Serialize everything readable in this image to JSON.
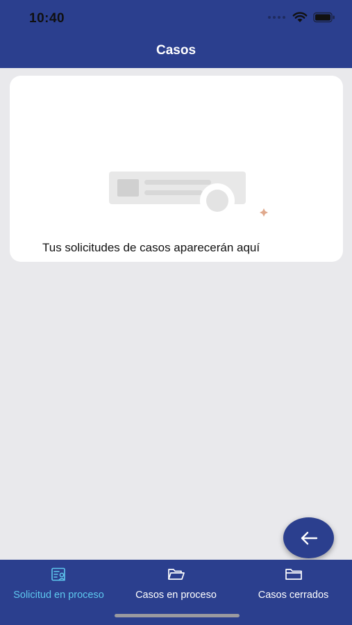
{
  "status_bar": {
    "time": "10:40",
    "icons": [
      "signal-dots-icon",
      "wifi-icon",
      "battery-icon"
    ]
  },
  "header": {
    "title": "Casos",
    "background_color": "#2b3f8e"
  },
  "empty_state": {
    "illustration": "empty-cases-illustration",
    "message": "Tus solicitudes de casos aparecerán aquí"
  },
  "fab": {
    "icon": "arrow-left-icon"
  },
  "bottom_nav": {
    "active_color": "#5ec8ef",
    "items": [
      {
        "label": "Solicitud en proceso",
        "icon": "document-user-icon",
        "active": true
      },
      {
        "label": "Casos en proceso",
        "icon": "folder-open-icon",
        "active": false
      },
      {
        "label": "Casos cerrados",
        "icon": "folder-icon",
        "active": false
      }
    ]
  }
}
